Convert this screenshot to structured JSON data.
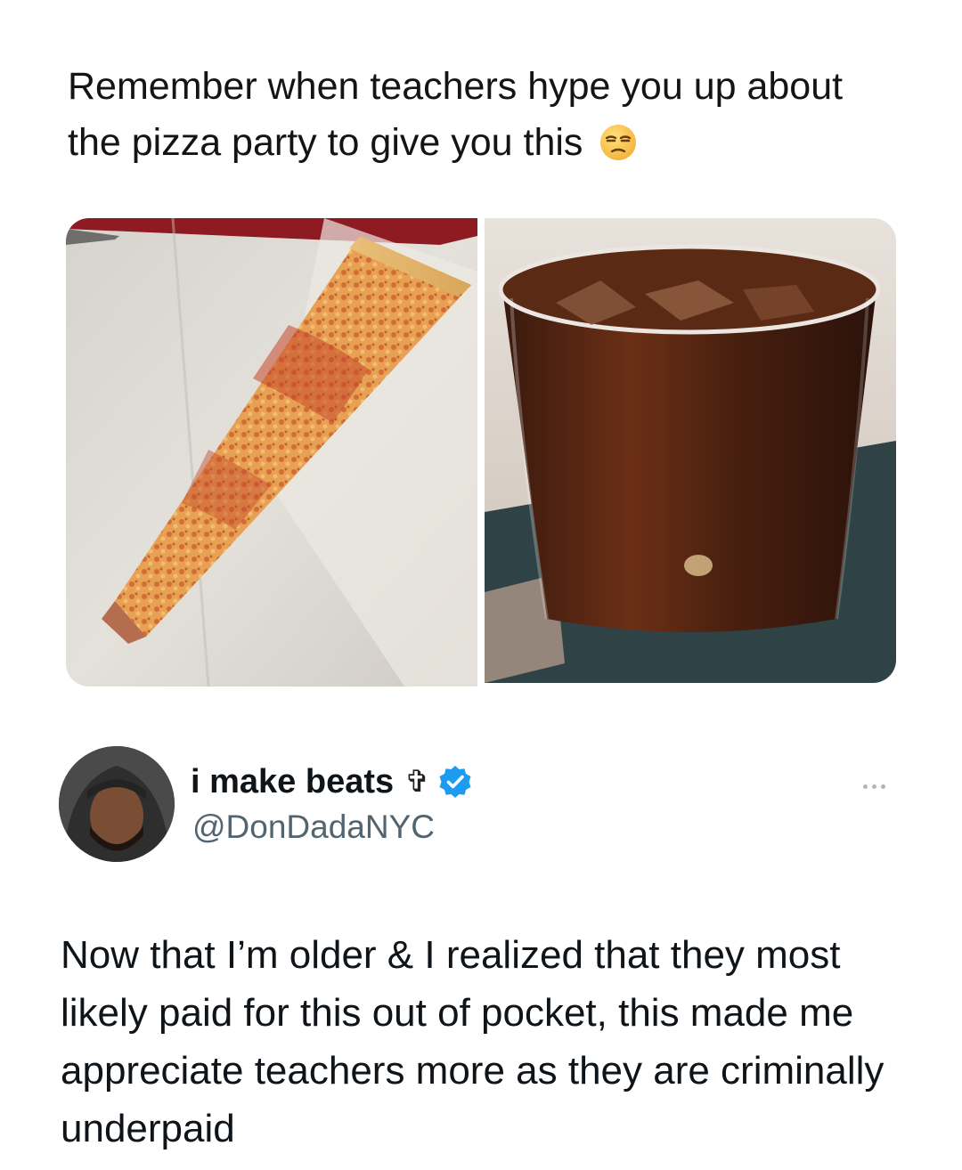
{
  "meme": {
    "caption": "Remember when teachers hype you up about the pizza party to give you this",
    "caption_emoji": "unamused-face-icon"
  },
  "tweet": {
    "display_name": "i make beats",
    "name_symbol": "✞",
    "verified": true,
    "handle": "@DonDadaNYC",
    "text": "Now that I’m older & I realized that they most likely paid for this out of pocket, this made me appreciate teachers more as they are criminally underpaid",
    "more_icon": "more-options-icon"
  },
  "colors": {
    "verified_badge": "#1d9bf0",
    "handle_gray": "#536471",
    "text": "#0f1419"
  }
}
